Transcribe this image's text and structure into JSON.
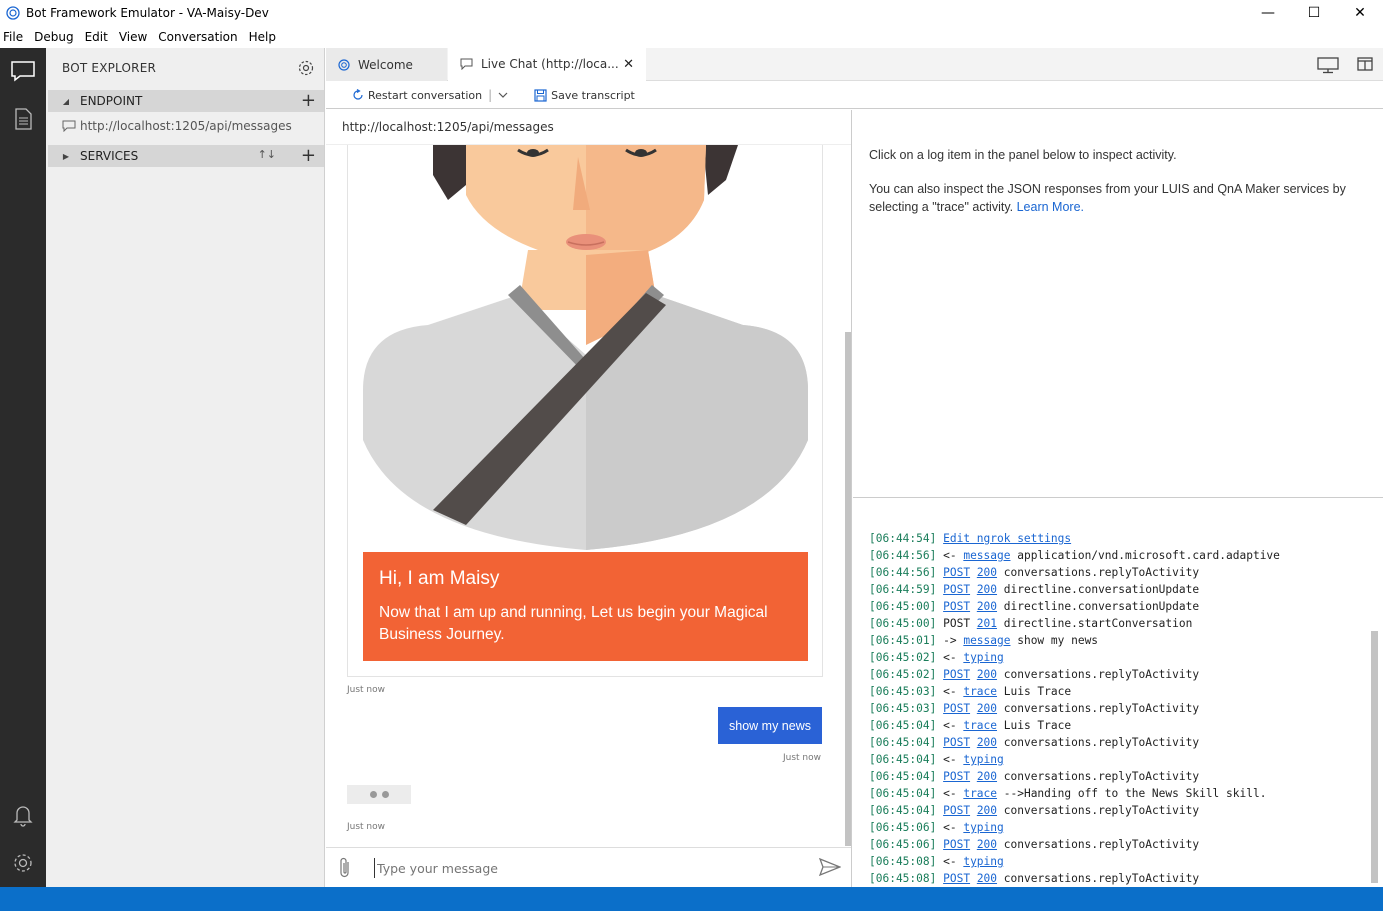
{
  "window": {
    "title": "Bot Framework Emulator - VA-Maisy-Dev",
    "minimize": "—",
    "maximize": "☐",
    "close": "✕"
  },
  "menu": [
    "File",
    "Debug",
    "Edit",
    "View",
    "Conversation",
    "Help"
  ],
  "explorer": {
    "header": "BOT EXPLORER",
    "endpoint_label": "ENDPOINT",
    "endpoint_url": "http://localhost:1205/api/messages",
    "services_label": "SERVICES"
  },
  "tabs": [
    {
      "label": "Welcome"
    },
    {
      "label": "Live Chat (http://loca..."
    }
  ],
  "toolbar": {
    "restart": "Restart conversation",
    "save": "Save transcript"
  },
  "chat": {
    "url": "http://localhost:1205/api/messages",
    "card_title": "Hi, I am Maisy",
    "card_text": "Now that I am up and running, Let us begin your Magical Business Journey.",
    "bot_time": "Just now",
    "user_message": "show my news",
    "user_time": "Just now",
    "typing_time": "Just now",
    "input_placeholder": "Type your message"
  },
  "inspector": {
    "line1": "Click on a log item in the panel below to inspect activity.",
    "line2": "You can also inspect the JSON responses from your LUIS and QnA Maker services by selecting a \"trace\" activity.",
    "learn_more": "Learn More."
  },
  "log": [
    {
      "time": "[06:44:54]",
      "parts": [
        {
          "t": "Edit ngrok settings",
          "link": true
        }
      ]
    },
    {
      "time": "[06:44:56]",
      "parts": [
        {
          "t": "<- ",
          "link": false
        },
        {
          "t": "message",
          "link": true
        },
        {
          "t": " application/vnd.microsoft.card.adaptive",
          "link": false
        }
      ]
    },
    {
      "time": "[06:44:56]",
      "parts": [
        {
          "t": "POST",
          "link": true
        },
        {
          "t": " ",
          "link": false
        },
        {
          "t": "200",
          "link": true
        },
        {
          "t": " conversations.replyToActivity",
          "link": false
        }
      ]
    },
    {
      "time": "[06:44:59]",
      "parts": [
        {
          "t": "POST",
          "link": true
        },
        {
          "t": " ",
          "link": false
        },
        {
          "t": "200",
          "link": true
        },
        {
          "t": " directline.conversationUpdate",
          "link": false
        }
      ]
    },
    {
      "time": "[06:45:00]",
      "parts": [
        {
          "t": "POST",
          "link": true
        },
        {
          "t": " ",
          "link": false
        },
        {
          "t": "200",
          "link": true
        },
        {
          "t": " directline.conversationUpdate",
          "link": false
        }
      ]
    },
    {
      "time": "[06:45:00]",
      "parts": [
        {
          "t": "POST ",
          "link": false
        },
        {
          "t": "201",
          "link": true
        },
        {
          "t": " directline.startConversation",
          "link": false
        }
      ]
    },
    {
      "time": "[06:45:01]",
      "parts": [
        {
          "t": "-> ",
          "link": false
        },
        {
          "t": "message",
          "link": true
        },
        {
          "t": " show my news",
          "link": false
        }
      ]
    },
    {
      "time": "[06:45:02]",
      "parts": [
        {
          "t": "<- ",
          "link": false
        },
        {
          "t": "typing",
          "link": true
        }
      ]
    },
    {
      "time": "[06:45:02]",
      "parts": [
        {
          "t": "POST",
          "link": true
        },
        {
          "t": " ",
          "link": false
        },
        {
          "t": "200",
          "link": true
        },
        {
          "t": " conversations.replyToActivity",
          "link": false
        }
      ]
    },
    {
      "time": "[06:45:03]",
      "parts": [
        {
          "t": "<- ",
          "link": false
        },
        {
          "t": "trace",
          "link": true
        },
        {
          "t": " Luis Trace",
          "link": false
        }
      ]
    },
    {
      "time": "[06:45:03]",
      "parts": [
        {
          "t": "POST",
          "link": true
        },
        {
          "t": " ",
          "link": false
        },
        {
          "t": "200",
          "link": true
        },
        {
          "t": " conversations.replyToActivity",
          "link": false
        }
      ]
    },
    {
      "time": "[06:45:04]",
      "parts": [
        {
          "t": "<- ",
          "link": false
        },
        {
          "t": "trace",
          "link": true
        },
        {
          "t": " Luis Trace",
          "link": false
        }
      ]
    },
    {
      "time": "[06:45:04]",
      "parts": [
        {
          "t": "POST",
          "link": true
        },
        {
          "t": " ",
          "link": false
        },
        {
          "t": "200",
          "link": true
        },
        {
          "t": " conversations.replyToActivity",
          "link": false
        }
      ]
    },
    {
      "time": "[06:45:04]",
      "parts": [
        {
          "t": "<- ",
          "link": false
        },
        {
          "t": "typing",
          "link": true
        }
      ]
    },
    {
      "time": "[06:45:04]",
      "parts": [
        {
          "t": "POST",
          "link": true
        },
        {
          "t": " ",
          "link": false
        },
        {
          "t": "200",
          "link": true
        },
        {
          "t": " conversations.replyToActivity",
          "link": false
        }
      ]
    },
    {
      "time": "[06:45:04]",
      "parts": [
        {
          "t": "<- ",
          "link": false
        },
        {
          "t": "trace",
          "link": true
        },
        {
          "t": " -->Handing off to the News Skill skill.",
          "link": false
        }
      ]
    },
    {
      "time": "[06:45:04]",
      "parts": [
        {
          "t": "POST",
          "link": true
        },
        {
          "t": " ",
          "link": false
        },
        {
          "t": "200",
          "link": true
        },
        {
          "t": " conversations.replyToActivity",
          "link": false
        }
      ]
    },
    {
      "time": "[06:45:06]",
      "parts": [
        {
          "t": "<- ",
          "link": false
        },
        {
          "t": "typing",
          "link": true
        }
      ]
    },
    {
      "time": "[06:45:06]",
      "parts": [
        {
          "t": "POST",
          "link": true
        },
        {
          "t": " ",
          "link": false
        },
        {
          "t": "200",
          "link": true
        },
        {
          "t": " conversations.replyToActivity",
          "link": false
        }
      ]
    },
    {
      "time": "[06:45:08]",
      "parts": [
        {
          "t": "<- ",
          "link": false
        },
        {
          "t": "typing",
          "link": true
        }
      ]
    },
    {
      "time": "[06:45:08]",
      "parts": [
        {
          "t": "POST",
          "link": true
        },
        {
          "t": " ",
          "link": false
        },
        {
          "t": "200",
          "link": true
        },
        {
          "t": " conversations.replyToActivity",
          "link": false
        }
      ]
    }
  ],
  "colors": {
    "accent": "#0b6fc9",
    "card_banner": "#f26335",
    "user_bubble": "#2a62d6",
    "activity_bar": "#2b2b2b"
  }
}
